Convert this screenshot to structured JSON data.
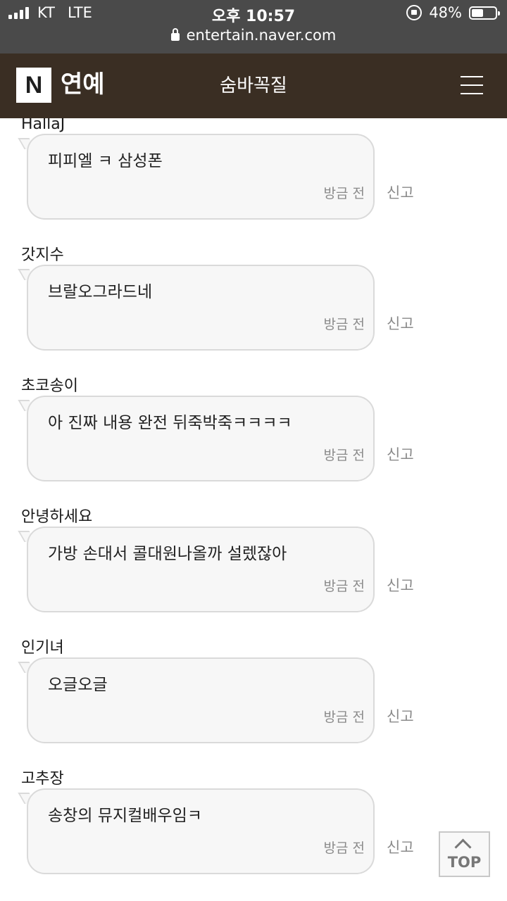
{
  "status_bar": {
    "carrier": "KT",
    "network": "LTE",
    "time": "오후 10:57",
    "battery": "48%",
    "battery_level": 0.48,
    "url": "entertain.naver.com"
  },
  "header": {
    "logo": "N",
    "section": "연예",
    "title": "숨바꼭질",
    "menu_icon": "hamburger-menu-icon"
  },
  "comments": [
    {
      "author": "HallaJ",
      "text": "피피엘 ㅋ 삼성폰",
      "time": "방금 전",
      "report": "신고"
    },
    {
      "author": "갓지수",
      "text": "브랄오그라드네",
      "time": "방금 전",
      "report": "신고"
    },
    {
      "author": "초코송이",
      "text": "아 진짜 내용 완전 뒤죽박죽ㅋㅋㅋㅋ",
      "time": "방금 전",
      "report": "신고"
    },
    {
      "author": "안녕하세요",
      "text": "가방 손대서 콜대원나올까 설렜잖아",
      "time": "방금 전",
      "report": "신고"
    },
    {
      "author": "인기녀",
      "text": "오글오글",
      "time": "방금 전",
      "report": "신고"
    },
    {
      "author": "고추장",
      "text": "송창의 뮤지컬배우임ㅋ",
      "time": "방금 전",
      "report": "신고"
    }
  ],
  "top_button": {
    "label": "TOP"
  },
  "colors": {
    "header_bg": "#3a2e23",
    "status_bg": "#4a4a4a",
    "bubble_bg": "#f7f7f7"
  }
}
